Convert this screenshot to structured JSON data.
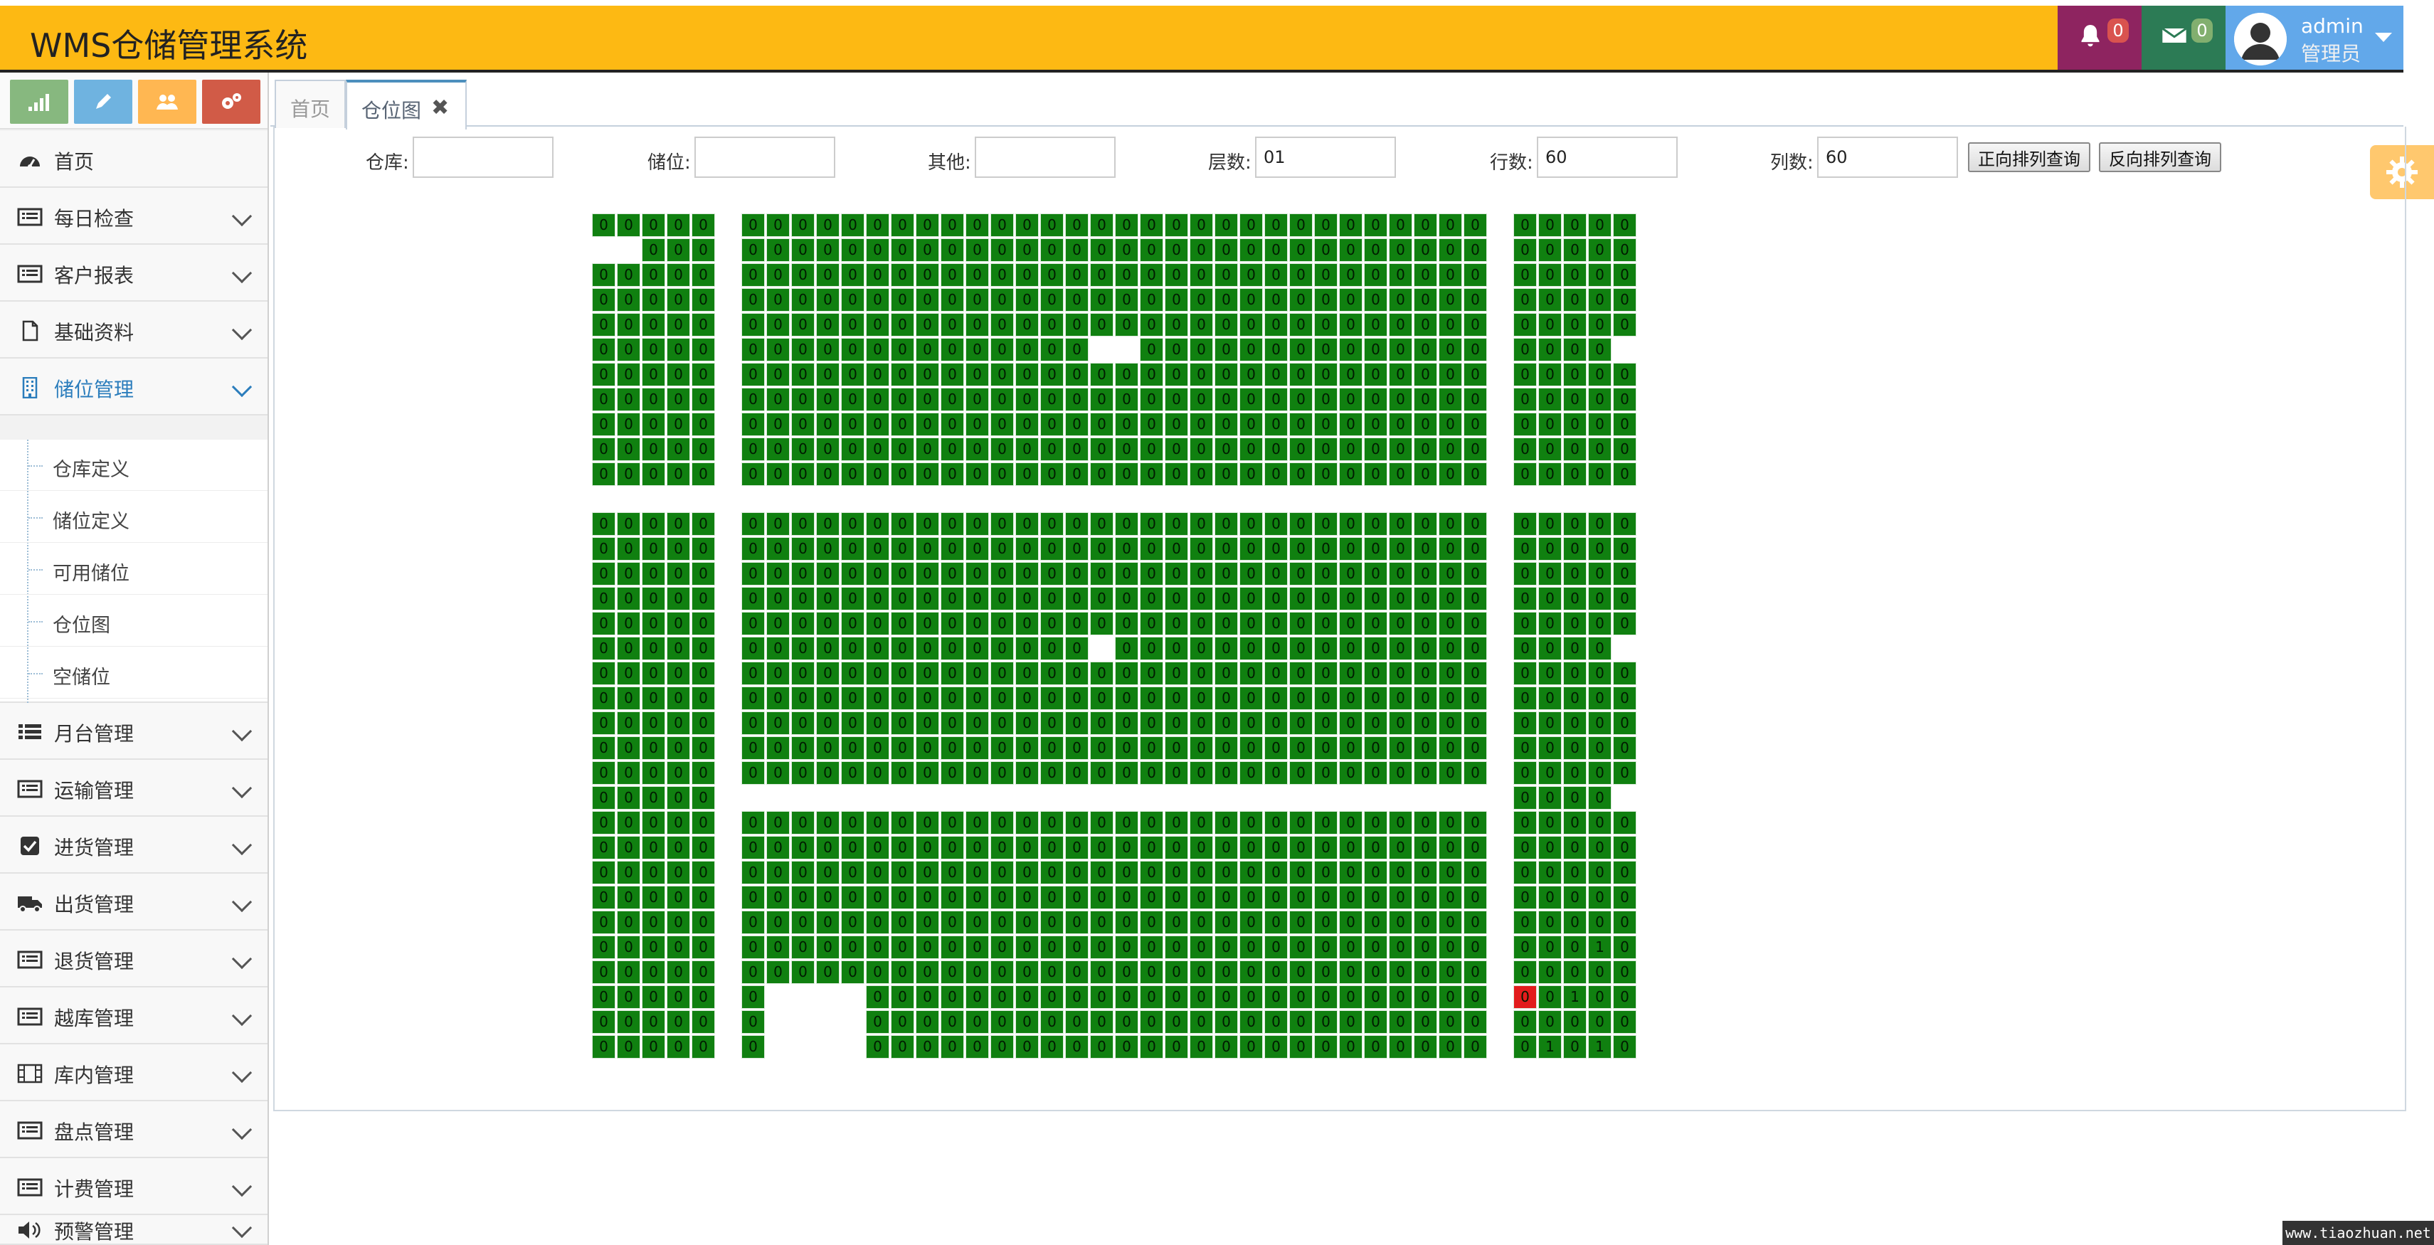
{
  "app": {
    "title": "WMS仓储管理系统"
  },
  "header": {
    "notifications": {
      "count": "0"
    },
    "messages": {
      "count": "0"
    },
    "user": {
      "name": "admin",
      "role": "管理员"
    }
  },
  "colors": {
    "header_bg": "#FDB913",
    "bell_bg": "#8e2460",
    "mail_bg": "#2c7b55",
    "user_bg": "#62a8ea",
    "cell_normal": "#108010",
    "cell_highlight": "#e21c1c",
    "active_menu": "#2b7dbc"
  },
  "shortcuts": [
    {
      "icon": "signal-icon",
      "color": "#87b87f"
    },
    {
      "icon": "pencil-icon",
      "color": "#6fb3e0"
    },
    {
      "icon": "users-icon",
      "color": "#ffb752"
    },
    {
      "icon": "cogs-icon",
      "color": "#d15b47"
    }
  ],
  "sidebar": {
    "items": [
      {
        "label": "首页",
        "icon": "dashboard-icon"
      },
      {
        "label": "每日检查",
        "icon": "list-icon"
      },
      {
        "label": "客户报表",
        "icon": "list-icon"
      },
      {
        "label": "基础资料",
        "icon": "file-icon"
      },
      {
        "label": "储位管理",
        "icon": "building-icon",
        "active": true
      },
      {
        "label": "月台管理",
        "icon": "list-ul-icon"
      },
      {
        "label": "运输管理",
        "icon": "list-icon"
      },
      {
        "label": "进货管理",
        "icon": "check-square-icon"
      },
      {
        "label": "出货管理",
        "icon": "truck-icon"
      },
      {
        "label": "退货管理",
        "icon": "list-icon"
      },
      {
        "label": "越库管理",
        "icon": "list-icon"
      },
      {
        "label": "库内管理",
        "icon": "film-icon"
      },
      {
        "label": "盘点管理",
        "icon": "list-icon"
      },
      {
        "label": "计费管理",
        "icon": "list-icon"
      },
      {
        "label": "预警管理",
        "icon": "volume-icon"
      }
    ],
    "submenu": [
      {
        "label": "仓库定义"
      },
      {
        "label": "储位定义"
      },
      {
        "label": "可用储位"
      },
      {
        "label": "仓位图"
      },
      {
        "label": "空储位"
      }
    ]
  },
  "tabs": [
    {
      "label": "首页"
    },
    {
      "label": "仓位图",
      "active": true,
      "closable": true
    }
  ],
  "filters": {
    "warehouse": {
      "label": "仓库:",
      "value": ""
    },
    "location": {
      "label": "储位:",
      "value": ""
    },
    "other": {
      "label": "其他:",
      "value": ""
    },
    "layers": {
      "label": "层数:",
      "value": "01"
    },
    "rows": {
      "label": "行数:",
      "value": "60"
    },
    "cols": {
      "label": "列数:",
      "value": "60"
    }
  },
  "buttons": {
    "forward_query": "正向排列查询",
    "reverse_query": "反向排列查询"
  },
  "location_map": {
    "default_value": "0",
    "rows": 34,
    "cols": 42,
    "filled_rows": [
      [
        0,
        1,
        2,
        3,
        4,
        6,
        7,
        8,
        9,
        10,
        11,
        12,
        13,
        14,
        15,
        16,
        17,
        18,
        19,
        20,
        21,
        22,
        23,
        24,
        25,
        26,
        27,
        28,
        29,
        30,
        31,
        32,
        33,
        34,
        35,
        37,
        38,
        39,
        40,
        41
      ],
      [
        2,
        3,
        4,
        6,
        7,
        8,
        9,
        10,
        11,
        12,
        13,
        14,
        15,
        16,
        17,
        18,
        19,
        20,
        21,
        22,
        23,
        24,
        25,
        26,
        27,
        28,
        29,
        30,
        31,
        32,
        33,
        34,
        35,
        37,
        38,
        39,
        40,
        41
      ],
      [
        0,
        1,
        2,
        3,
        4,
        6,
        7,
        8,
        9,
        10,
        11,
        12,
        13,
        14,
        15,
        16,
        17,
        18,
        19,
        20,
        21,
        22,
        23,
        24,
        25,
        26,
        27,
        28,
        29,
        30,
        31,
        32,
        33,
        34,
        35,
        37,
        38,
        39,
        40,
        41
      ],
      [
        0,
        1,
        2,
        3,
        4,
        6,
        7,
        8,
        9,
        10,
        11,
        12,
        13,
        14,
        15,
        16,
        17,
        18,
        19,
        20,
        21,
        22,
        23,
        24,
        25,
        26,
        27,
        28,
        29,
        30,
        31,
        32,
        33,
        34,
        35,
        37,
        38,
        39,
        40,
        41
      ],
      [
        0,
        1,
        2,
        3,
        4,
        6,
        7,
        8,
        9,
        10,
        11,
        12,
        13,
        14,
        15,
        16,
        17,
        18,
        19,
        20,
        21,
        22,
        23,
        24,
        25,
        26,
        27,
        28,
        29,
        30,
        31,
        32,
        33,
        34,
        35,
        37,
        38,
        39,
        40,
        41
      ],
      [
        0,
        1,
        2,
        3,
        4,
        6,
        7,
        8,
        9,
        10,
        11,
        12,
        13,
        14,
        15,
        16,
        17,
        18,
        19,
        22,
        23,
        24,
        25,
        26,
        27,
        28,
        29,
        30,
        31,
        32,
        33,
        34,
        35,
        37,
        38,
        39,
        40
      ],
      [
        0,
        1,
        2,
        3,
        4,
        6,
        7,
        8,
        9,
        10,
        11,
        12,
        13,
        14,
        15,
        16,
        17,
        18,
        19,
        20,
        21,
        22,
        23,
        24,
        25,
        26,
        27,
        28,
        29,
        30,
        31,
        32,
        33,
        34,
        35,
        37,
        38,
        39,
        40,
        41
      ],
      [
        0,
        1,
        2,
        3,
        4,
        6,
        7,
        8,
        9,
        10,
        11,
        12,
        13,
        14,
        15,
        16,
        17,
        18,
        19,
        20,
        21,
        22,
        23,
        24,
        25,
        26,
        27,
        28,
        29,
        30,
        31,
        32,
        33,
        34,
        35,
        37,
        38,
        39,
        40,
        41
      ],
      [
        0,
        1,
        2,
        3,
        4,
        6,
        7,
        8,
        9,
        10,
        11,
        12,
        13,
        14,
        15,
        16,
        17,
        18,
        19,
        20,
        21,
        22,
        23,
        24,
        25,
        26,
        27,
        28,
        29,
        30,
        31,
        32,
        33,
        34,
        35,
        37,
        38,
        39,
        40,
        41
      ],
      [
        0,
        1,
        2,
        3,
        4,
        6,
        7,
        8,
        9,
        10,
        11,
        12,
        13,
        14,
        15,
        16,
        17,
        18,
        19,
        20,
        21,
        22,
        23,
        24,
        25,
        26,
        27,
        28,
        29,
        30,
        31,
        32,
        33,
        34,
        35,
        37,
        38,
        39,
        40,
        41
      ],
      [
        0,
        1,
        2,
        3,
        4,
        6,
        7,
        8,
        9,
        10,
        11,
        12,
        13,
        14,
        15,
        16,
        17,
        18,
        19,
        20,
        21,
        22,
        23,
        24,
        25,
        26,
        27,
        28,
        29,
        30,
        31,
        32,
        33,
        34,
        35,
        37,
        38,
        39,
        40,
        41
      ],
      [],
      [
        0,
        1,
        2,
        3,
        4,
        6,
        7,
        8,
        9,
        10,
        11,
        12,
        13,
        14,
        15,
        16,
        17,
        18,
        19,
        20,
        21,
        22,
        23,
        24,
        25,
        26,
        27,
        28,
        29,
        30,
        31,
        32,
        33,
        34,
        35,
        37,
        38,
        39,
        40,
        41
      ],
      [
        0,
        1,
        2,
        3,
        4,
        6,
        7,
        8,
        9,
        10,
        11,
        12,
        13,
        14,
        15,
        16,
        17,
        18,
        19,
        20,
        21,
        22,
        23,
        24,
        25,
        26,
        27,
        28,
        29,
        30,
        31,
        32,
        33,
        34,
        35,
        37,
        38,
        39,
        40,
        41
      ],
      [
        0,
        1,
        2,
        3,
        4,
        6,
        7,
        8,
        9,
        10,
        11,
        12,
        13,
        14,
        15,
        16,
        17,
        18,
        19,
        20,
        21,
        22,
        23,
        24,
        25,
        26,
        27,
        28,
        29,
        30,
        31,
        32,
        33,
        34,
        35,
        37,
        38,
        39,
        40,
        41
      ],
      [
        0,
        1,
        2,
        3,
        4,
        6,
        7,
        8,
        9,
        10,
        11,
        12,
        13,
        14,
        15,
        16,
        17,
        18,
        19,
        20,
        21,
        22,
        23,
        24,
        25,
        26,
        27,
        28,
        29,
        30,
        31,
        32,
        33,
        34,
        35,
        37,
        38,
        39,
        40,
        41
      ],
      [
        0,
        1,
        2,
        3,
        4,
        6,
        7,
        8,
        9,
        10,
        11,
        12,
        13,
        14,
        15,
        16,
        17,
        18,
        19,
        20,
        21,
        22,
        23,
        24,
        25,
        26,
        27,
        28,
        29,
        30,
        31,
        32,
        33,
        34,
        35,
        37,
        38,
        39,
        40,
        41
      ],
      [
        0,
        1,
        2,
        3,
        4,
        6,
        7,
        8,
        9,
        10,
        11,
        12,
        13,
        14,
        15,
        16,
        17,
        18,
        19,
        21,
        22,
        23,
        24,
        25,
        26,
        27,
        28,
        29,
        30,
        31,
        32,
        33,
        34,
        35,
        37,
        38,
        39,
        40
      ],
      [
        0,
        1,
        2,
        3,
        4,
        6,
        7,
        8,
        9,
        10,
        11,
        12,
        13,
        14,
        15,
        16,
        17,
        18,
        19,
        20,
        21,
        22,
        23,
        24,
        25,
        26,
        27,
        28,
        29,
        30,
        31,
        32,
        33,
        34,
        35,
        37,
        38,
        39,
        40,
        41
      ],
      [
        0,
        1,
        2,
        3,
        4,
        6,
        7,
        8,
        9,
        10,
        11,
        12,
        13,
        14,
        15,
        16,
        17,
        18,
        19,
        20,
        21,
        22,
        23,
        24,
        25,
        26,
        27,
        28,
        29,
        30,
        31,
        32,
        33,
        34,
        35,
        37,
        38,
        39,
        40,
        41
      ],
      [
        0,
        1,
        2,
        3,
        4,
        6,
        7,
        8,
        9,
        10,
        11,
        12,
        13,
        14,
        15,
        16,
        17,
        18,
        19,
        20,
        21,
        22,
        23,
        24,
        25,
        26,
        27,
        28,
        29,
        30,
        31,
        32,
        33,
        34,
        35,
        37,
        38,
        39,
        40,
        41
      ],
      [
        0,
        1,
        2,
        3,
        4,
        6,
        7,
        8,
        9,
        10,
        11,
        12,
        13,
        14,
        15,
        16,
        17,
        18,
        19,
        20,
        21,
        22,
        23,
        24,
        25,
        26,
        27,
        28,
        29,
        30,
        31,
        32,
        33,
        34,
        35,
        37,
        38,
        39,
        40,
        41
      ],
      [
        0,
        1,
        2,
        3,
        4,
        6,
        7,
        8,
        9,
        10,
        11,
        12,
        13,
        14,
        15,
        16,
        17,
        18,
        19,
        20,
        21,
        22,
        23,
        24,
        25,
        26,
        27,
        28,
        29,
        30,
        31,
        32,
        33,
        34,
        35,
        37,
        38,
        39,
        40,
        41
      ],
      [
        0,
        1,
        2,
        3,
        4,
        37,
        38,
        39,
        40
      ],
      [
        0,
        1,
        2,
        3,
        4,
        6,
        7,
        8,
        9,
        10,
        11,
        12,
        13,
        14,
        15,
        16,
        17,
        18,
        19,
        20,
        21,
        22,
        23,
        24,
        25,
        26,
        27,
        28,
        29,
        30,
        31,
        32,
        33,
        34,
        35,
        37,
        38,
        39,
        40,
        41
      ],
      [
        0,
        1,
        2,
        3,
        4,
        6,
        7,
        8,
        9,
        10,
        11,
        12,
        13,
        14,
        15,
        16,
        17,
        18,
        19,
        20,
        21,
        22,
        23,
        24,
        25,
        26,
        27,
        28,
        29,
        30,
        31,
        32,
        33,
        34,
        35,
        37,
        38,
        39,
        40,
        41
      ],
      [
        0,
        1,
        2,
        3,
        4,
        6,
        7,
        8,
        9,
        10,
        11,
        12,
        13,
        14,
        15,
        16,
        17,
        18,
        19,
        20,
        21,
        22,
        23,
        24,
        25,
        26,
        27,
        28,
        29,
        30,
        31,
        32,
        33,
        34,
        35,
        37,
        38,
        39,
        40,
        41
      ],
      [
        0,
        1,
        2,
        3,
        4,
        6,
        7,
        8,
        9,
        10,
        11,
        12,
        13,
        14,
        15,
        16,
        17,
        18,
        19,
        20,
        21,
        22,
        23,
        24,
        25,
        26,
        27,
        28,
        29,
        30,
        31,
        32,
        33,
        34,
        35,
        37,
        38,
        39,
        40,
        41
      ],
      [
        0,
        1,
        2,
        3,
        4,
        6,
        7,
        8,
        9,
        10,
        11,
        12,
        13,
        14,
        15,
        16,
        17,
        18,
        19,
        20,
        21,
        22,
        23,
        24,
        25,
        26,
        27,
        28,
        29,
        30,
        31,
        32,
        33,
        34,
        35,
        37,
        38,
        39,
        40,
        41
      ],
      [
        0,
        1,
        2,
        3,
        4,
        6,
        7,
        8,
        9,
        10,
        11,
        12,
        13,
        14,
        15,
        16,
        17,
        18,
        19,
        20,
        21,
        22,
        23,
        24,
        25,
        26,
        27,
        28,
        29,
        30,
        31,
        32,
        33,
        34,
        35,
        37,
        38,
        39,
        40,
        41
      ],
      [
        0,
        1,
        2,
        3,
        4,
        6,
        7,
        8,
        9,
        10,
        11,
        12,
        13,
        14,
        15,
        16,
        17,
        18,
        19,
        20,
        21,
        22,
        23,
        24,
        25,
        26,
        27,
        28,
        29,
        30,
        31,
        32,
        33,
        34,
        35,
        37,
        38,
        39,
        40,
        41
      ],
      [
        0,
        1,
        2,
        3,
        4,
        6,
        11,
        12,
        13,
        14,
        15,
        16,
        17,
        18,
        19,
        20,
        21,
        22,
        23,
        24,
        25,
        26,
        27,
        28,
        29,
        30,
        31,
        32,
        33,
        34,
        35,
        37,
        38,
        39,
        40,
        41
      ],
      [
        0,
        1,
        2,
        3,
        4,
        6,
        11,
        12,
        13,
        14,
        15,
        16,
        17,
        18,
        19,
        20,
        21,
        22,
        23,
        24,
        25,
        26,
        27,
        28,
        29,
        30,
        31,
        32,
        33,
        34,
        35,
        37,
        38,
        39,
        40,
        41
      ],
      [
        0,
        1,
        2,
        3,
        4,
        6,
        11,
        12,
        13,
        14,
        15,
        16,
        17,
        18,
        19,
        20,
        21,
        22,
        23,
        24,
        25,
        26,
        27,
        28,
        29,
        30,
        31,
        32,
        33,
        34,
        35,
        37,
        38,
        39,
        40,
        41
      ]
    ],
    "highlight_cells": [
      [
        31,
        37
      ]
    ],
    "special_values": [
      {
        "row": 31,
        "col": 39,
        "value": "1"
      },
      {
        "row": 33,
        "col": 38,
        "value": "1"
      },
      {
        "row": 33,
        "col": 40,
        "value": "1"
      },
      {
        "row": 29,
        "col": 40,
        "value": "1"
      }
    ]
  },
  "watermark": "www.tiaozhuan.net"
}
